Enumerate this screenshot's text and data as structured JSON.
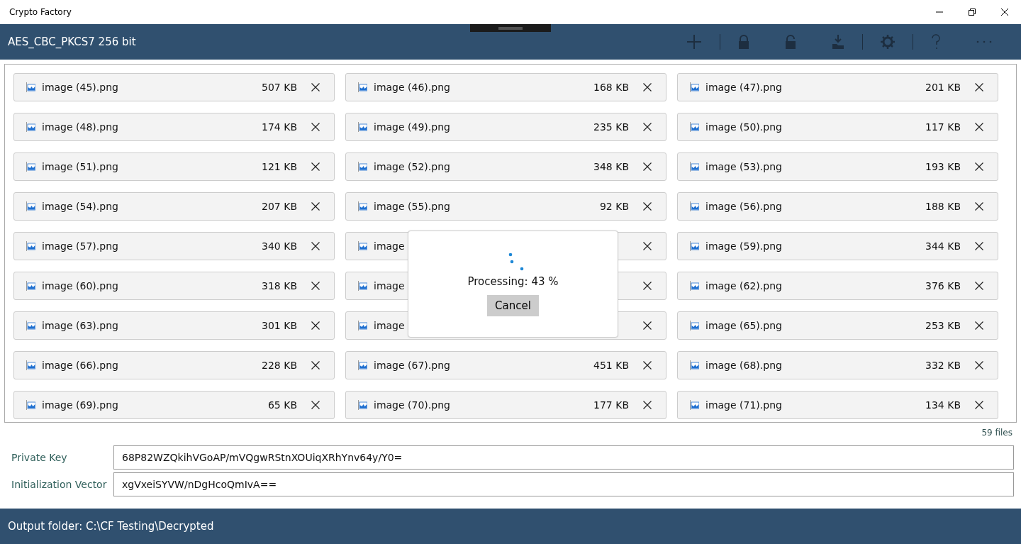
{
  "window": {
    "title": "Crypto Factory"
  },
  "toolbar": {
    "algorithm": "AES_CBC_PKCS7 256 bit"
  },
  "files": [
    {
      "name": "image (45).png",
      "size": "507 KB"
    },
    {
      "name": "image (46).png",
      "size": "168 KB"
    },
    {
      "name": "image (47).png",
      "size": "201 KB"
    },
    {
      "name": "image (48).png",
      "size": "174 KB"
    },
    {
      "name": "image (49).png",
      "size": "235 KB"
    },
    {
      "name": "image (50).png",
      "size": "117 KB"
    },
    {
      "name": "image (51).png",
      "size": "121 KB"
    },
    {
      "name": "image (52).png",
      "size": "348 KB"
    },
    {
      "name": "image (53).png",
      "size": "193 KB"
    },
    {
      "name": "image (54).png",
      "size": "207 KB"
    },
    {
      "name": "image (55).png",
      "size": "92 KB"
    },
    {
      "name": "image (56).png",
      "size": "188 KB"
    },
    {
      "name": "image (57).png",
      "size": "340 KB"
    },
    {
      "name": "image"
    },
    {
      "name": "image (59).png",
      "size": "344 KB"
    },
    {
      "name": "image (60).png",
      "size": "318 KB"
    },
    {
      "name": "image"
    },
    {
      "name": "image (62).png",
      "size": "376 KB"
    },
    {
      "name": "image (63).png",
      "size": "301 KB"
    },
    {
      "name": "image"
    },
    {
      "name": "image (65).png",
      "size": "253 KB"
    },
    {
      "name": "image (66).png",
      "size": "228 KB"
    },
    {
      "name": "image (67).png",
      "size": "451 KB"
    },
    {
      "name": "image (68).png",
      "size": "332 KB"
    },
    {
      "name": "image (69).png",
      "size": "65 KB"
    },
    {
      "name": "image (70).png",
      "size": "177 KB"
    },
    {
      "name": "image (71).png",
      "size": "134 KB"
    }
  ],
  "file_count": "59 files",
  "fields": [
    {
      "label": "Private Key",
      "value": "68P82WZQkihVGoAP/mVQgwRStnXOUiqXRhYnv64y/Y0="
    },
    {
      "label": "Initialization Vector",
      "value": "xgVxeiSYVW/nDgHcoQmIvA=="
    }
  ],
  "dialog": {
    "message": "Processing: 43 %",
    "button": "Cancel"
  },
  "status_bar": "Output folder: C:\\CF Testing\\Decrypted"
}
